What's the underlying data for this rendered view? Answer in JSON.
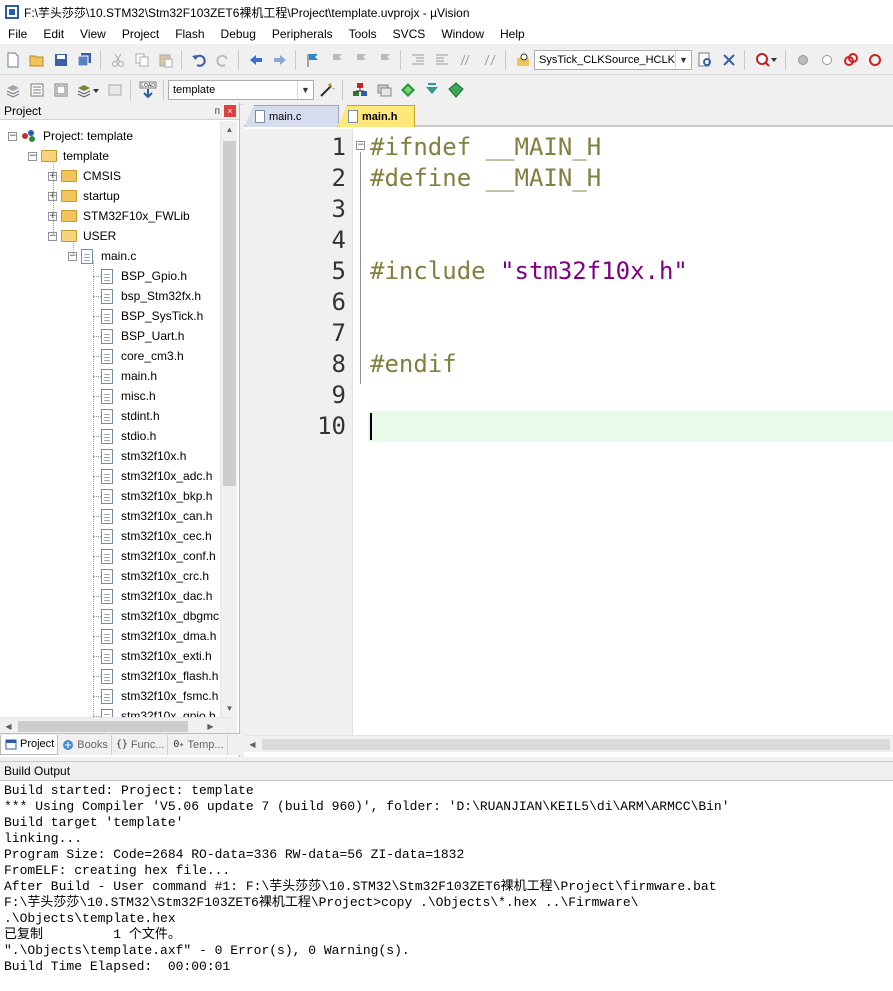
{
  "window": {
    "title": "F:\\芋头莎莎\\10.STM32\\Stm32F103ZET6裸机工程\\Project\\template.uvprojx - µVision"
  },
  "menu": [
    "File",
    "Edit",
    "View",
    "Project",
    "Flash",
    "Debug",
    "Peripherals",
    "Tools",
    "SVCS",
    "Window",
    "Help"
  ],
  "toolbar1": {
    "function_dropdown": "SysTick_CLKSource_HCLK"
  },
  "toolbar2": {
    "target_dropdown": "template",
    "load_label": "LOAD"
  },
  "project_panel": {
    "title": "Project",
    "pin": "ᴨ",
    "close": "×",
    "tree": {
      "root": "Project: template",
      "target": "template",
      "groups": [
        "CMSIS",
        "startup",
        "STM32F10x_FWLib",
        "USER"
      ],
      "user_file": "main.c",
      "includes": [
        "BSP_Gpio.h",
        "bsp_Stm32fx.h",
        "BSP_SysTick.h",
        "BSP_Uart.h",
        "core_cm3.h",
        "main.h",
        "misc.h",
        "stdint.h",
        "stdio.h",
        "stm32f10x.h",
        "stm32f10x_adc.h",
        "stm32f10x_bkp.h",
        "stm32f10x_can.h",
        "stm32f10x_cec.h",
        "stm32f10x_conf.h",
        "stm32f10x_crc.h",
        "stm32f10x_dac.h",
        "stm32f10x_dbgmc",
        "stm32f10x_dma.h",
        "stm32f10x_exti.h",
        "stm32f10x_flash.h",
        "stm32f10x_fsmc.h",
        "stm32f10x_gpio.h"
      ]
    },
    "tabs": [
      {
        "label": "Project",
        "icon": "project-icon"
      },
      {
        "label": "Books",
        "icon": "books-icon"
      },
      {
        "label": "Func...",
        "icon": "functions-icon"
      },
      {
        "label": "Temp...",
        "icon": "templates-icon"
      }
    ]
  },
  "editor": {
    "tabs": [
      {
        "label": "main.c",
        "active": false
      },
      {
        "label": "main.h",
        "active": true
      }
    ],
    "line_numbers": [
      "1",
      "2",
      "3",
      "4",
      "5",
      "6",
      "7",
      "8",
      "9",
      "10"
    ],
    "lines": [
      {
        "pp": "#ifndef",
        "rest": " __MAIN_H"
      },
      {
        "pp": "#define",
        "rest": " __MAIN_H"
      },
      {
        "pp": "",
        "rest": ""
      },
      {
        "pp": "",
        "rest": ""
      },
      {
        "pp": "#include",
        "str": " \"stm32f10x.h\""
      },
      {
        "pp": "",
        "rest": ""
      },
      {
        "pp": "",
        "rest": ""
      },
      {
        "pp": "#endif",
        "rest": ""
      },
      {
        "pp": "",
        "rest": ""
      },
      {
        "pp": "",
        "rest": ""
      }
    ],
    "current_line": 10,
    "fold_marker": "−"
  },
  "build_output": {
    "title": "Build Output",
    "lines": [
      "Build started: Project: template",
      "*** Using Compiler 'V5.06 update 7 (build 960)', folder: 'D:\\RUANJIAN\\KEIL5\\di\\ARM\\ARMCC\\Bin'",
      "Build target 'template'",
      "linking...",
      "Program Size: Code=2684 RO-data=336 RW-data=56 ZI-data=1832",
      "FromELF: creating hex file...",
      "After Build - User command #1: F:\\芋头莎莎\\10.STM32\\Stm32F103ZET6裸机工程\\Project\\firmware.bat",
      "F:\\芋头莎莎\\10.STM32\\Stm32F103ZET6裸机工程\\Project>copy .\\Objects\\*.hex ..\\Firmware\\",
      ".\\Objects\\template.hex",
      "已复制         1 个文件。",
      "\".\\Objects\\template.axf\" - 0 Error(s), 0 Warning(s).",
      "Build Time Elapsed:  00:00:01"
    ]
  },
  "scroll_arrows": {
    "up": "▲",
    "down": "▼",
    "left": "◀",
    "right": "▶"
  }
}
